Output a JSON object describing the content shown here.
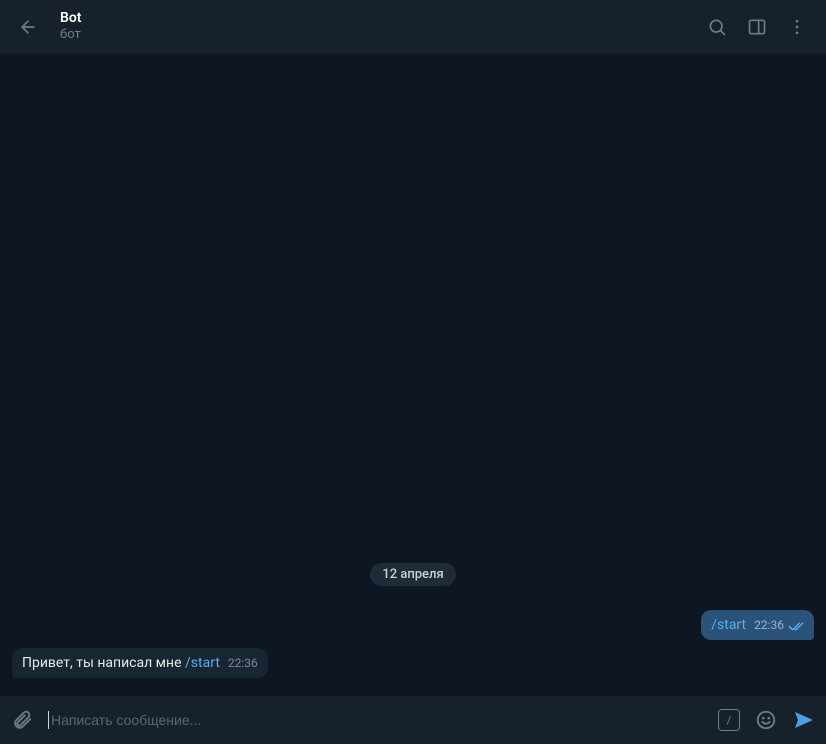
{
  "header": {
    "title": "Bot",
    "subtitle": "бот"
  },
  "chat": {
    "date_label": "12 апреля",
    "messages": [
      {
        "direction": "out",
        "text": "/start",
        "is_command": true,
        "time": "22:36",
        "read": true
      },
      {
        "direction": "in",
        "text_prefix": "Привет, ты написал мне ",
        "command": "/start",
        "time": "22:36"
      }
    ]
  },
  "composer": {
    "placeholder": "Написать сообщение...",
    "slash_label": "/"
  },
  "icons": {
    "back": "arrow-left",
    "search": "search",
    "sidepanel": "side-panel",
    "menu": "dots-vertical",
    "attach": "paperclip",
    "commands": "slash-box",
    "emoji": "smile",
    "send": "send"
  }
}
